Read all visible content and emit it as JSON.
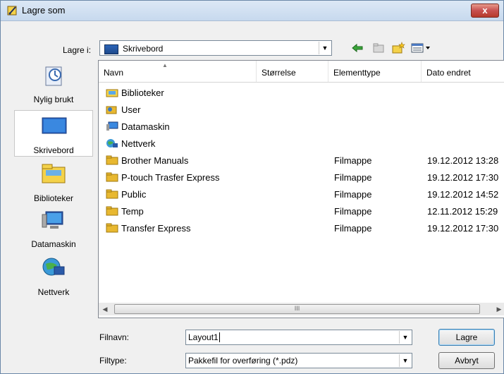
{
  "window": {
    "title": "Lagre som",
    "close": "x"
  },
  "toolbar": {
    "lookin_label": "Lagre i:",
    "lookin_value": "Skrivebord",
    "dropdown_arrow": "▼"
  },
  "places": [
    {
      "label": "Nylig brukt",
      "icon": "recent-icon"
    },
    {
      "label": "Skrivebord",
      "icon": "desktop-icon",
      "selected": true
    },
    {
      "label": "Biblioteker",
      "icon": "libraries-icon"
    },
    {
      "label": "Datamaskin",
      "icon": "computer-icon"
    },
    {
      "label": "Nettverk",
      "icon": "network-icon"
    }
  ],
  "columns": [
    "Navn",
    "Størrelse",
    "Elementtype",
    "Dato endret"
  ],
  "files": [
    {
      "name": "Biblioteker",
      "size": "",
      "type": "",
      "date": "",
      "icon": "library"
    },
    {
      "name": "User",
      "size": "",
      "type": "",
      "date": "",
      "icon": "user"
    },
    {
      "name": "Datamaskin",
      "size": "",
      "type": "",
      "date": "",
      "icon": "computer"
    },
    {
      "name": "Nettverk",
      "size": "",
      "type": "",
      "date": "",
      "icon": "network"
    },
    {
      "name": "Brother Manuals",
      "size": "",
      "type": "Filmappe",
      "date": "19.12.2012 13:28",
      "icon": "folder"
    },
    {
      "name": "P-touch Trasfer Express",
      "size": "",
      "type": "Filmappe",
      "date": "19.12.2012 17:30",
      "icon": "folder"
    },
    {
      "name": "Public",
      "size": "",
      "type": "Filmappe",
      "date": "19.12.2012 14:52",
      "icon": "folder"
    },
    {
      "name": "Temp",
      "size": "",
      "type": "Filmappe",
      "date": "12.11.2012 15:29",
      "icon": "folder"
    },
    {
      "name": "Transfer Express",
      "size": "",
      "type": "Filmappe",
      "date": "19.12.2012 17:30",
      "icon": "folder"
    }
  ],
  "scrollbar": {
    "left": "◀",
    "right": "▶",
    "grip": "III"
  },
  "form": {
    "filename_label": "Filnavn:",
    "filename_value": "Layout1",
    "filetype_label": "Filtype:",
    "filetype_value": "Pakkefil for overføring (*.pdz)",
    "save_button": "Lagre",
    "cancel_button": "Avbryt"
  },
  "colors": {
    "folder": "#e8b830",
    "accent": "#2a64b8"
  }
}
